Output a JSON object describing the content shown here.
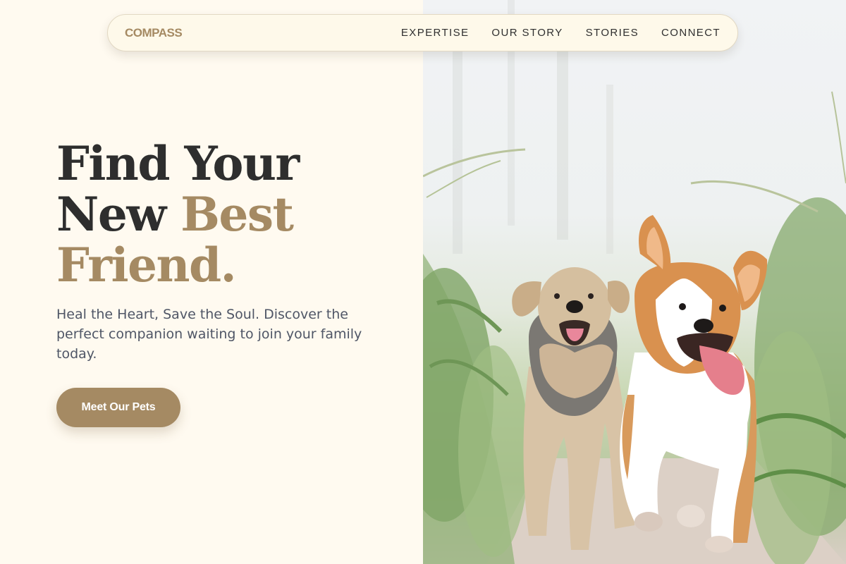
{
  "brand": {
    "logo": "COMPASS"
  },
  "nav": {
    "links": [
      "EXPERTISE",
      "OUR STORY",
      "STORIES",
      "CONNECT"
    ]
  },
  "hero": {
    "headline_line1": "Find Your",
    "headline_line2_plain": "New ",
    "headline_line2_accent": "Best",
    "headline_line3_accent": "Friend.",
    "tagline": "Heal the Heart, Save the Soul. Discover the perfect companion waiting to join your family today.",
    "cta_label": "Meet Our Pets"
  },
  "image": {
    "subject": "two dogs running on a path through tall grass"
  },
  "colors": {
    "background": "#fffaf0",
    "accent": "#a58a63",
    "heading": "#2e2e2e",
    "body_text": "#4f5666",
    "nav_background": "#fef9ea"
  }
}
